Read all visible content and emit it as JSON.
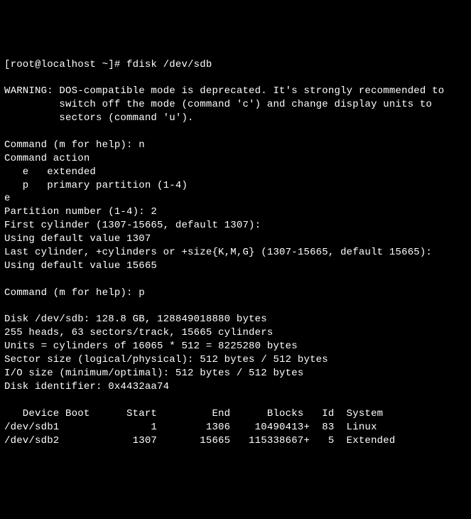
{
  "line1": "[root@localhost ~]# fdisk /dev/sdb",
  "warning1": "WARNING: DOS-compatible mode is deprecated. It's strongly recommended to",
  "warning2": "         switch off the mode (command 'c') and change display units to",
  "warning3": "         sectors (command 'u').",
  "cmd1_prompt": "Command (m for help): n",
  "cmd_action": "Command action",
  "opt_e": "   e   extended",
  "opt_p": "   p   primary partition (1-4)",
  "choice_e": "e",
  "part_num": "Partition number (1-4): 2",
  "first_cyl": "First cylinder (1307-15665, default 1307):",
  "def_first": "Using default value 1307",
  "last_cyl": "Last cylinder, +cylinders or +size{K,M,G} (1307-15665, default 15665):",
  "def_last": "Using default value 15665",
  "cmd2_prompt": "Command (m for help): p",
  "disk_info": "Disk /dev/sdb: 128.8 GB, 128849018880 bytes",
  "heads": "255 heads, 63 sectors/track, 15665 cylinders",
  "units": "Units = cylinders of 16065 * 512 = 8225280 bytes",
  "sector": "Sector size (logical/physical): 512 bytes / 512 bytes",
  "io": "I/O size (minimum/optimal): 512 bytes / 512 bytes",
  "diskid": "Disk identifier: 0x4432aa74",
  "th": "   Device Boot      Start         End      Blocks   Id  System",
  "row1": "/dev/sdb1               1        1306    10490413+  83  Linux",
  "row2": "/dev/sdb2            1307       15665   115338667+   5  Extended"
}
